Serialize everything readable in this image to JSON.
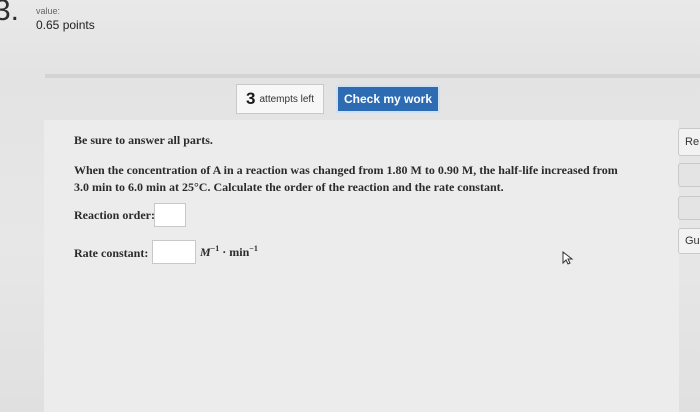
{
  "question": {
    "number": "3.",
    "value_label": "value:",
    "points": "0.65 points"
  },
  "toolbar": {
    "attempts_count": "3",
    "attempts_text": "attempts left",
    "check_label": "Check my work"
  },
  "problem": {
    "instructions": "Be sure to answer all parts.",
    "statement": "When the concentration of A in a reaction was changed from 1.80 M to 0.90 M, the half-life increased from 3.0 min to 6.0 min at 25°C. Calculate the order of the reaction and the rate constant.",
    "order_label": "Reaction order:",
    "rate_label": "Rate constant:",
    "rate_units": {
      "m_base": "M",
      "m_exp": "−1",
      "dot": "·",
      "min_base": "min",
      "min_exp": "−1"
    },
    "order_value": "",
    "rate_value": ""
  },
  "side_panel": {
    "button1_label": "Re",
    "button3_label": "Gu"
  },
  "icons": {
    "cursor": "mouse-pointer-icon"
  },
  "colors": {
    "accent": "#2d6bb3"
  }
}
